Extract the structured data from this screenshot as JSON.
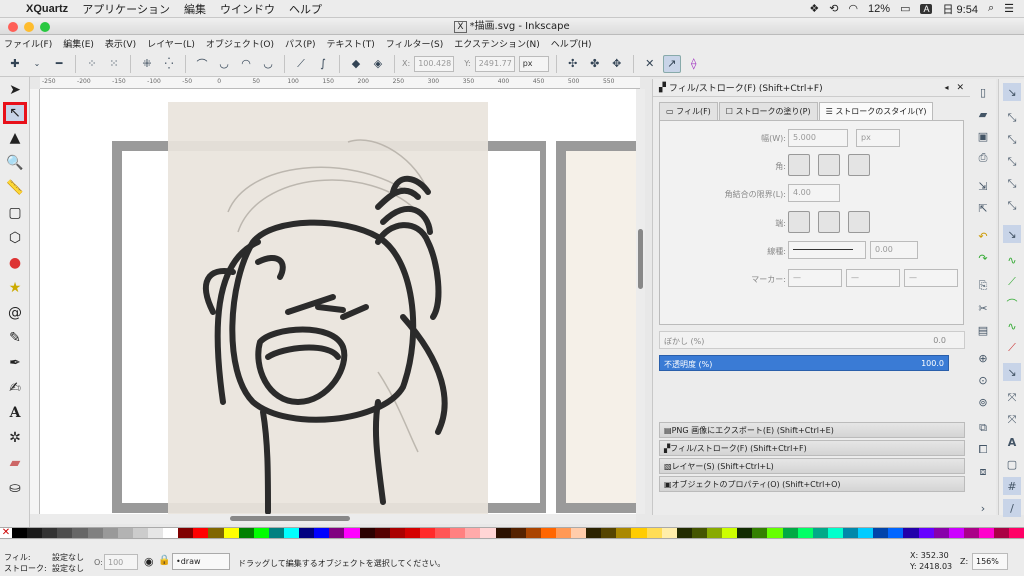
{
  "macbar": {
    "app": "XQuartz",
    "menus": [
      "アプリケーション",
      "編集",
      "ウインドウ",
      "ヘルプ"
    ],
    "battery": "12%",
    "ime": "A",
    "time": "日 9:54"
  },
  "window": {
    "title": "*描画.svg - Inkscape"
  },
  "menu": [
    "ファイル(F)",
    "編集(E)",
    "表示(V)",
    "レイヤー(L)",
    "オブジェクト(O)",
    "パス(P)",
    "テキスト(T)",
    "フィルター(S)",
    "エクステンション(N)",
    "ヘルプ(H)"
  ],
  "cmdbar": {
    "x_label": "X:",
    "x_value": "100.428",
    "y_label": "Y:",
    "y_value": "2491.77",
    "unit": "px"
  },
  "ruler_ticks": [
    "-250",
    "-200",
    "-150",
    "-100",
    "-50",
    "0",
    "50",
    "100",
    "150",
    "200",
    "250",
    "300",
    "350",
    "400",
    "450",
    "500",
    "550"
  ],
  "panel": {
    "title": "フィル/ストローク(F) (Shift+Ctrl+F)",
    "tabs": [
      "フィル(F)",
      "ストロークの塗り(P)",
      "ストロークのスタイル(Y)"
    ],
    "width_label": "幅(W):",
    "width_value": "5.000",
    "width_unit": "px",
    "corner_label": "角:",
    "miter_label": "角結合の限界(L):",
    "miter_value": "4.00",
    "cap_label": "端:",
    "dash_label": "線種:",
    "dash_value": "0.00",
    "marker_label": "マーカー:",
    "blur_label": "ぼかし (%)",
    "blur_value": "0.0",
    "opacity_label": "不透明度 (%)",
    "opacity_value": "100.0",
    "docks": [
      "PNG 画像にエクスポート(E) (Shift+Ctrl+E)",
      "フィル/ストローク(F) (Shift+Ctrl+F)",
      "レイヤー(S) (Shift+Ctrl+L)",
      "オブジェクトのプロパティ(O) (Shift+Ctrl+O)"
    ]
  },
  "status": {
    "fill_label": "フィル:",
    "fill_value": "設定なし",
    "stroke_label": "ストローク:",
    "stroke_value": "設定なし",
    "opacity_label": "O:",
    "opacity_value": "100",
    "layer": "•draw",
    "message": "ドラッグして編集するオブジェクトを選択してください。",
    "x": "X: 352.30",
    "y": "Y: 2418.03",
    "zoom_label": "Z:",
    "zoom": "156%"
  },
  "colors": {
    "accent": "#3a7bd5",
    "highlight": "#e8101a",
    "opacity_bar": "#3a7bd5"
  }
}
